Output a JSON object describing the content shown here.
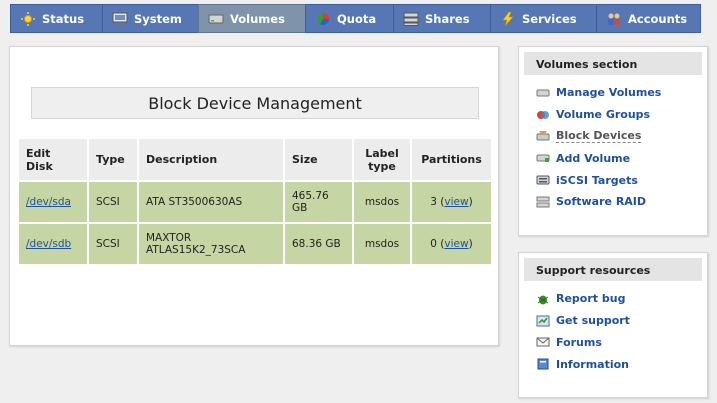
{
  "nav": {
    "tabs": [
      {
        "label": "Status",
        "icon": "sun-icon"
      },
      {
        "label": "System",
        "icon": "monitor-icon"
      },
      {
        "label": "Volumes",
        "icon": "drive-icon",
        "active": true
      },
      {
        "label": "Quota",
        "icon": "pie-icon"
      },
      {
        "label": "Shares",
        "icon": "server-icon"
      },
      {
        "label": "Services",
        "icon": "bolt-icon"
      },
      {
        "label": "Accounts",
        "icon": "users-icon"
      }
    ]
  },
  "main": {
    "title": "Block Device Management",
    "table": {
      "headers": {
        "edit_disk": "Edit Disk",
        "type": "Type",
        "description": "Description",
        "size": "Size",
        "label_type": "Label type",
        "partitions": "Partitions"
      },
      "rows": [
        {
          "disk": "/dev/sda",
          "type": "SCSI",
          "description": "ATA ST3500630AS",
          "size": "465.76 GB",
          "label_type": "msdos",
          "partitions_count": "3",
          "view_link": "view"
        },
        {
          "disk": "/dev/sdb",
          "type": "SCSI",
          "description": "MAXTOR ATLAS15K2_73SCA",
          "size": "68.36 GB",
          "label_type": "msdos",
          "partitions_count": "0",
          "view_link": "view"
        }
      ]
    }
  },
  "volumes_section": {
    "title": "Volumes section",
    "items": [
      {
        "label": "Manage Volumes",
        "icon": "drive-icon"
      },
      {
        "label": "Volume Groups",
        "icon": "group-icon"
      },
      {
        "label": "Block Devices",
        "icon": "tools-icon",
        "current": true
      },
      {
        "label": "Add Volume",
        "icon": "drive-add-icon"
      },
      {
        "label": "iSCSI Targets",
        "icon": "iscsi-icon"
      },
      {
        "label": "Software RAID",
        "icon": "raid-icon"
      }
    ]
  },
  "support_section": {
    "title": "Support resources",
    "items": [
      {
        "label": "Report bug",
        "icon": "bug-icon"
      },
      {
        "label": "Get support",
        "icon": "support-icon"
      },
      {
        "label": "Forums",
        "icon": "mail-icon"
      },
      {
        "label": "Information",
        "icon": "book-icon"
      }
    ]
  }
}
